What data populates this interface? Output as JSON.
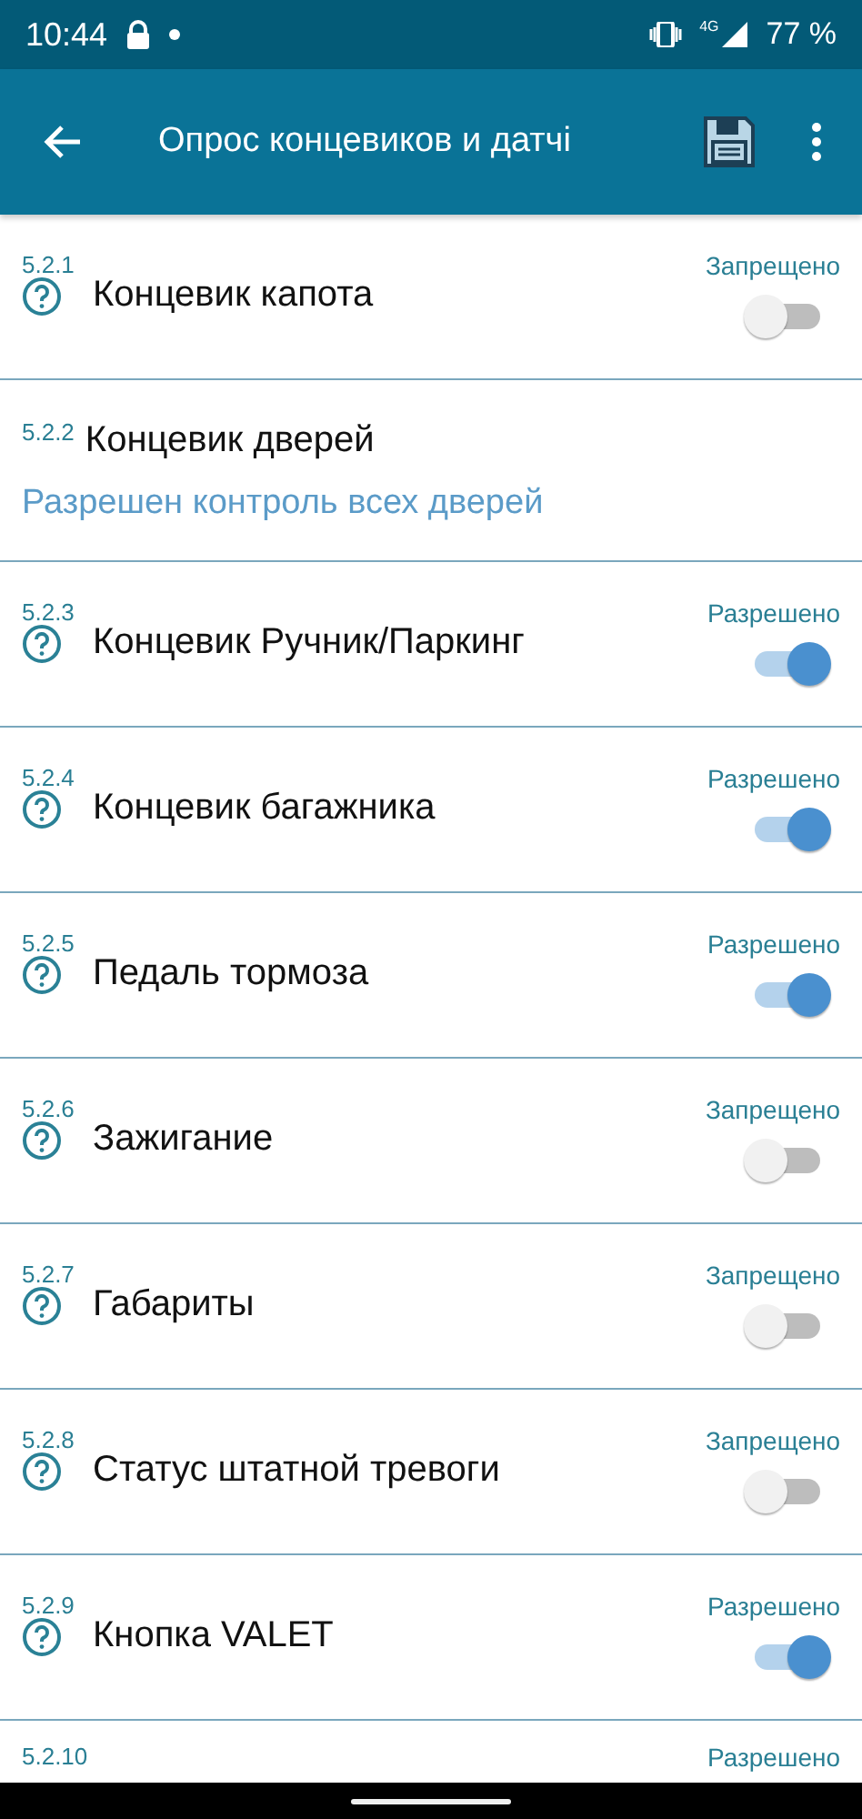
{
  "status_bar": {
    "time": "10:44",
    "network": "4G",
    "battery": "77 %"
  },
  "toolbar": {
    "title": "Опрос концевиков и датчі"
  },
  "items": [
    {
      "kind": "switch",
      "number": "5.2.1",
      "title": "Концевик капота",
      "status": "Запрещено",
      "on": false
    },
    {
      "kind": "text",
      "number": "5.2.2",
      "title": "Концевик дверей",
      "value": "Разрешен контроль всех дверей"
    },
    {
      "kind": "switch",
      "number": "5.2.3",
      "title": "Концевик Ручник/Паркинг",
      "status": "Разрешено",
      "on": true
    },
    {
      "kind": "switch",
      "number": "5.2.4",
      "title": "Концевик багажника",
      "status": "Разрешено",
      "on": true
    },
    {
      "kind": "switch",
      "number": "5.2.5",
      "title": "Педаль тормоза",
      "status": "Разрешено",
      "on": true
    },
    {
      "kind": "switch",
      "number": "5.2.6",
      "title": "Зажигание",
      "status": "Запрещено",
      "on": false
    },
    {
      "kind": "switch",
      "number": "5.2.7",
      "title": "Габариты",
      "status": "Запрещено",
      "on": false
    },
    {
      "kind": "switch",
      "number": "5.2.8",
      "title": "Статус штатной тревоги",
      "status": "Запрещено",
      "on": false
    },
    {
      "kind": "switch",
      "number": "5.2.9",
      "title": "Кнопка VALET",
      "status": "Разрешено",
      "on": true
    },
    {
      "kind": "partial",
      "number": "5.2.10",
      "status": "Разрешено"
    }
  ]
}
